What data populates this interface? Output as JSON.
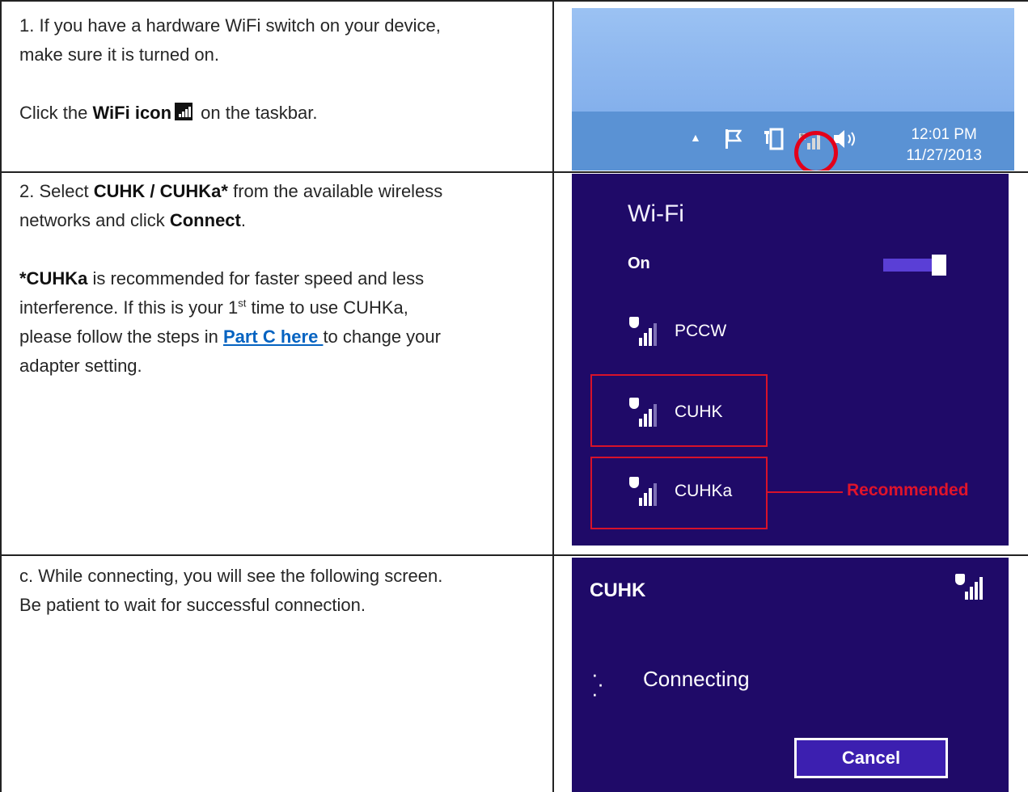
{
  "step1": {
    "line1": "1.  If you have a hardware WiFi switch on your device,",
    "line2": "make sure it is turned on.",
    "click_pre": "Click the ",
    "wifi_icon_label": "WiFi icon",
    "click_post": " on the taskbar."
  },
  "taskbar": {
    "time": "12:01 PM",
    "date": "11/27/2013",
    "icons": [
      "chevron-up-icon",
      "flag-icon",
      "battery-icon",
      "wifi-icon",
      "speaker-icon"
    ]
  },
  "step2": {
    "pre": "2. Select ",
    "networks_bold": "CUHK / CUHKa*",
    "mid": " from the available wireless",
    "line2_pre": "networks and click ",
    "connect_bold": "Connect",
    "line2_post": ".",
    "rec_bold": "*CUHKa",
    "rec_rest": " is recommended for faster speed and less",
    "line4_pre": "interference. If this is your 1",
    "line4_sup": "st",
    "line4_post": " time to use CUHKa,",
    "line5_pre": "please follow the steps in ",
    "link": "Part C here ",
    "line5_post": "to change your",
    "line6": "adapter setting."
  },
  "wifi_panel": {
    "title": "Wi-Fi",
    "on_label": "On",
    "networks": [
      "PCCW",
      "CUHK",
      "CUHKa"
    ],
    "recommended": "Recommended",
    "highlight_color": "#d8122a"
  },
  "step3": {
    "line1": "c. While connecting, you will see the following screen.",
    "line2": "Be patient to wait for successful connection."
  },
  "connect_panel": {
    "network": "CUHK",
    "status": "Connecting",
    "cancel": "Cancel"
  },
  "colors": {
    "panel_bg": "#1f0a68",
    "taskbar_bg": "#5a92d4",
    "link": "#0563c1"
  }
}
